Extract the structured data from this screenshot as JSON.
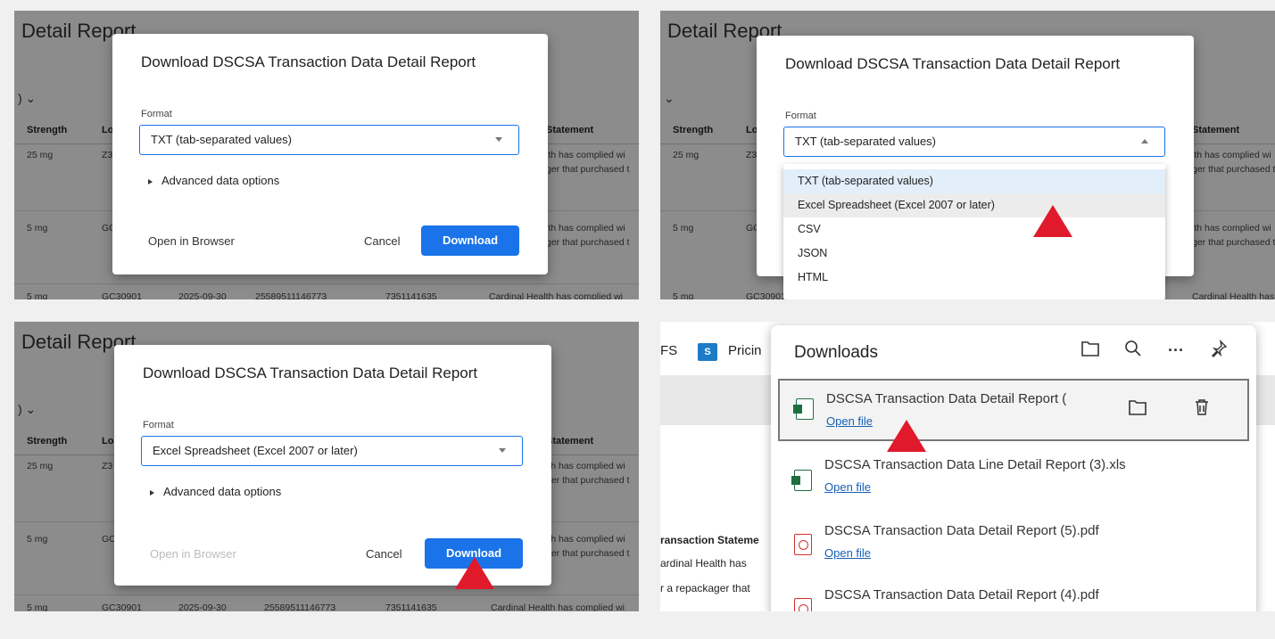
{
  "report_bg": {
    "title": "Detail Report",
    "headers": [
      "Strength",
      "Lo",
      "Statement"
    ],
    "rows": [
      {
        "strength": "25 mg",
        "lot": "Z3",
        "statement1": "lth has complied wi",
        "statement2": "ger that purchased t"
      },
      {
        "strength": "5 mg",
        "lot": "GC",
        "statement1": "lth has complied wi",
        "statement2": "ger that purchased t"
      }
    ],
    "bottom_row": [
      "5 mg",
      "GC30901",
      "2025-09-30",
      "25589511146773",
      "7351141635",
      "Cardinal Health has complied wi"
    ]
  },
  "dialog": {
    "title": "Download DSCSA Transaction Data Detail Report",
    "format_label": "Format",
    "advanced_label": "Advanced data options",
    "open_in_browser": "Open in Browser",
    "cancel": "Cancel",
    "download": "Download"
  },
  "panel1": {
    "select_value": "TXT (tab-separated values)"
  },
  "panel2": {
    "select_value": "TXT (tab-separated values)",
    "options": [
      "TXT (tab-separated values)",
      "Excel Spreadsheet (Excel 2007 or later)",
      "CSV",
      "JSON",
      "HTML"
    ]
  },
  "panel3": {
    "select_value": "Excel Spreadsheet (Excel 2007 or later)"
  },
  "downloads": {
    "tab_fs": "FS",
    "tab_sp_icon": "S",
    "tab_pricing": "Pricin",
    "title": "Downloads",
    "header_icons": [
      "folder-icon",
      "search-icon",
      "more-icon",
      "pin-icon"
    ],
    "bg_text": [
      "ransaction Stateme",
      "ardinal Health has",
      "r a repackager that"
    ],
    "items": [
      {
        "name": "DSCSA Transaction Data Detail Report (",
        "open": "Open file",
        "type": "xls"
      },
      {
        "name": "DSCSA Transaction Data Line Detail Report (3).xls",
        "open": "Open file",
        "type": "xls"
      },
      {
        "name": "DSCSA Transaction Data Detail Report (5).pdf",
        "open": "Open file",
        "type": "pdf"
      },
      {
        "name": "DSCSA Transaction Data Detail Report (4).pdf",
        "open": "",
        "type": "pdf"
      }
    ]
  }
}
